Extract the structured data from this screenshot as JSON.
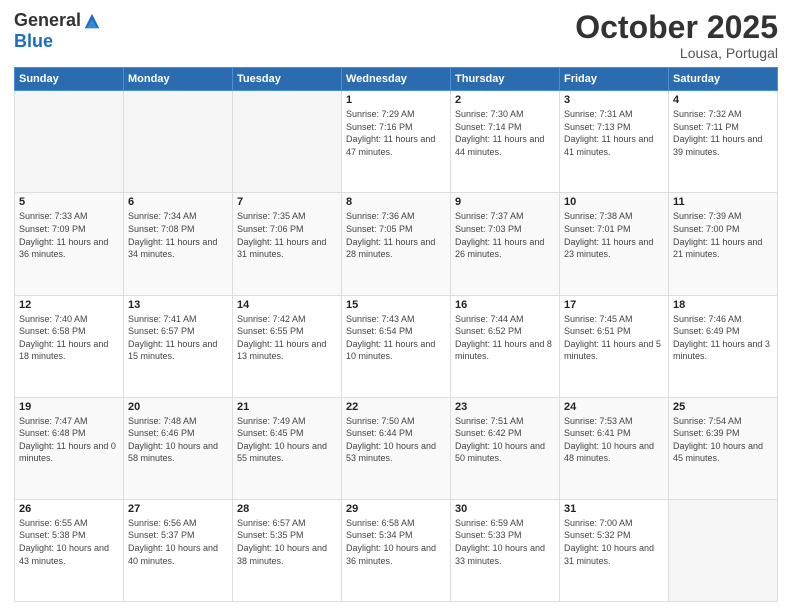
{
  "logo": {
    "general": "General",
    "blue": "Blue"
  },
  "header": {
    "month": "October 2025",
    "location": "Lousa, Portugal"
  },
  "days_of_week": [
    "Sunday",
    "Monday",
    "Tuesday",
    "Wednesday",
    "Thursday",
    "Friday",
    "Saturday"
  ],
  "weeks": [
    [
      {
        "day": "",
        "info": ""
      },
      {
        "day": "",
        "info": ""
      },
      {
        "day": "",
        "info": ""
      },
      {
        "day": "1",
        "info": "Sunrise: 7:29 AM\nSunset: 7:16 PM\nDaylight: 11 hours and 47 minutes."
      },
      {
        "day": "2",
        "info": "Sunrise: 7:30 AM\nSunset: 7:14 PM\nDaylight: 11 hours and 44 minutes."
      },
      {
        "day": "3",
        "info": "Sunrise: 7:31 AM\nSunset: 7:13 PM\nDaylight: 11 hours and 41 minutes."
      },
      {
        "day": "4",
        "info": "Sunrise: 7:32 AM\nSunset: 7:11 PM\nDaylight: 11 hours and 39 minutes."
      }
    ],
    [
      {
        "day": "5",
        "info": "Sunrise: 7:33 AM\nSunset: 7:09 PM\nDaylight: 11 hours and 36 minutes."
      },
      {
        "day": "6",
        "info": "Sunrise: 7:34 AM\nSunset: 7:08 PM\nDaylight: 11 hours and 34 minutes."
      },
      {
        "day": "7",
        "info": "Sunrise: 7:35 AM\nSunset: 7:06 PM\nDaylight: 11 hours and 31 minutes."
      },
      {
        "day": "8",
        "info": "Sunrise: 7:36 AM\nSunset: 7:05 PM\nDaylight: 11 hours and 28 minutes."
      },
      {
        "day": "9",
        "info": "Sunrise: 7:37 AM\nSunset: 7:03 PM\nDaylight: 11 hours and 26 minutes."
      },
      {
        "day": "10",
        "info": "Sunrise: 7:38 AM\nSunset: 7:01 PM\nDaylight: 11 hours and 23 minutes."
      },
      {
        "day": "11",
        "info": "Sunrise: 7:39 AM\nSunset: 7:00 PM\nDaylight: 11 hours and 21 minutes."
      }
    ],
    [
      {
        "day": "12",
        "info": "Sunrise: 7:40 AM\nSunset: 6:58 PM\nDaylight: 11 hours and 18 minutes."
      },
      {
        "day": "13",
        "info": "Sunrise: 7:41 AM\nSunset: 6:57 PM\nDaylight: 11 hours and 15 minutes."
      },
      {
        "day": "14",
        "info": "Sunrise: 7:42 AM\nSunset: 6:55 PM\nDaylight: 11 hours and 13 minutes."
      },
      {
        "day": "15",
        "info": "Sunrise: 7:43 AM\nSunset: 6:54 PM\nDaylight: 11 hours and 10 minutes."
      },
      {
        "day": "16",
        "info": "Sunrise: 7:44 AM\nSunset: 6:52 PM\nDaylight: 11 hours and 8 minutes."
      },
      {
        "day": "17",
        "info": "Sunrise: 7:45 AM\nSunset: 6:51 PM\nDaylight: 11 hours and 5 minutes."
      },
      {
        "day": "18",
        "info": "Sunrise: 7:46 AM\nSunset: 6:49 PM\nDaylight: 11 hours and 3 minutes."
      }
    ],
    [
      {
        "day": "19",
        "info": "Sunrise: 7:47 AM\nSunset: 6:48 PM\nDaylight: 11 hours and 0 minutes."
      },
      {
        "day": "20",
        "info": "Sunrise: 7:48 AM\nSunset: 6:46 PM\nDaylight: 10 hours and 58 minutes."
      },
      {
        "day": "21",
        "info": "Sunrise: 7:49 AM\nSunset: 6:45 PM\nDaylight: 10 hours and 55 minutes."
      },
      {
        "day": "22",
        "info": "Sunrise: 7:50 AM\nSunset: 6:44 PM\nDaylight: 10 hours and 53 minutes."
      },
      {
        "day": "23",
        "info": "Sunrise: 7:51 AM\nSunset: 6:42 PM\nDaylight: 10 hours and 50 minutes."
      },
      {
        "day": "24",
        "info": "Sunrise: 7:53 AM\nSunset: 6:41 PM\nDaylight: 10 hours and 48 minutes."
      },
      {
        "day": "25",
        "info": "Sunrise: 7:54 AM\nSunset: 6:39 PM\nDaylight: 10 hours and 45 minutes."
      }
    ],
    [
      {
        "day": "26",
        "info": "Sunrise: 6:55 AM\nSunset: 5:38 PM\nDaylight: 10 hours and 43 minutes."
      },
      {
        "day": "27",
        "info": "Sunrise: 6:56 AM\nSunset: 5:37 PM\nDaylight: 10 hours and 40 minutes."
      },
      {
        "day": "28",
        "info": "Sunrise: 6:57 AM\nSunset: 5:35 PM\nDaylight: 10 hours and 38 minutes."
      },
      {
        "day": "29",
        "info": "Sunrise: 6:58 AM\nSunset: 5:34 PM\nDaylight: 10 hours and 36 minutes."
      },
      {
        "day": "30",
        "info": "Sunrise: 6:59 AM\nSunset: 5:33 PM\nDaylight: 10 hours and 33 minutes."
      },
      {
        "day": "31",
        "info": "Sunrise: 7:00 AM\nSunset: 5:32 PM\nDaylight: 10 hours and 31 minutes."
      },
      {
        "day": "",
        "info": ""
      }
    ]
  ]
}
